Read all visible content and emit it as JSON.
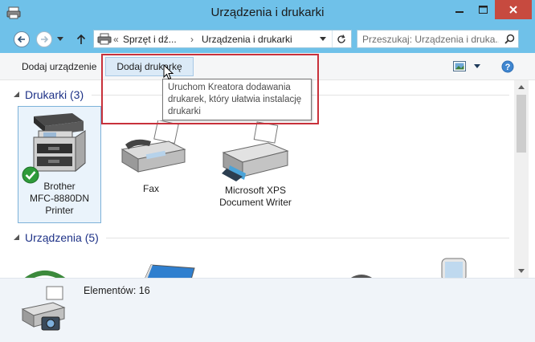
{
  "window": {
    "title": "Urządzenia i drukarki",
    "accent": "#6fc1e9",
    "close_color": "#c74a3f"
  },
  "address": {
    "prefix": "«",
    "crumbs": [
      "Sprzęt i dź...",
      "Urządzenia i drukarki"
    ],
    "separator": "›"
  },
  "search": {
    "placeholder": "Przeszukaj: Urządzenia i druka..."
  },
  "toolbar": {
    "add_device": "Dodaj urządzenie",
    "add_printer": "Dodaj drukarkę"
  },
  "tooltip": {
    "text": "Uruchom Kreatora dodawania drukarek, który ułatwia instalację drukarki"
  },
  "groups": {
    "printers": {
      "label": "Drukarki (3)",
      "items": [
        {
          "line1": "Brother",
          "line2": "MFC-8880DN",
          "line3": "Printer",
          "icon": "multifunction-printer-icon",
          "default": true
        },
        {
          "line1": "Fax",
          "icon": "fax-icon"
        },
        {
          "line1": "Microsoft XPS",
          "line2": "Document Writer",
          "icon": "xps-printer-icon"
        }
      ]
    },
    "devices": {
      "label": "Urządzenia (5)"
    }
  },
  "details": {
    "count": "Elementów: 16"
  },
  "highlight_color": "#c8313b"
}
